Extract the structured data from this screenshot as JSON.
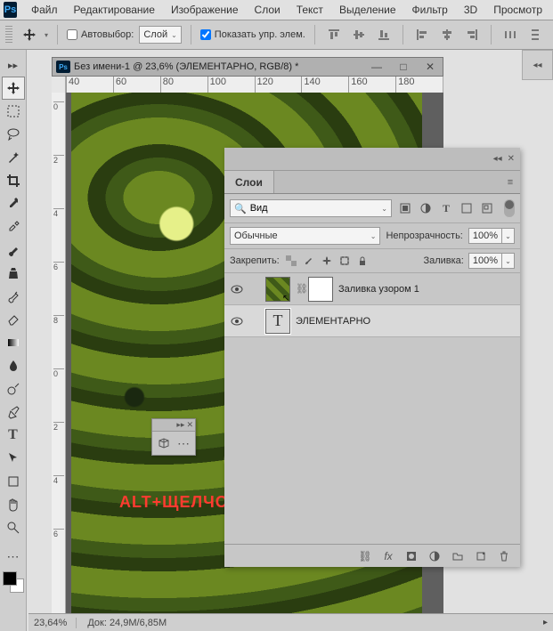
{
  "menu": {
    "items": [
      "Файл",
      "Редактирование",
      "Изображение",
      "Слои",
      "Текст",
      "Выделение",
      "Фильтр",
      "3D",
      "Просмотр"
    ]
  },
  "optionbar": {
    "autoselect_label": "Автовыбор:",
    "autoselect_checked": false,
    "scope_value": "Слой",
    "show_controls_label": "Показать упр. элем.",
    "show_controls_checked": true
  },
  "document": {
    "title": "Без имени-1 @ 23,6% (ЭЛЕМЕНТАРНО, RGB/8) *",
    "ruler_h": [
      "40",
      "60",
      "80",
      "100",
      "120",
      "140",
      "160",
      "180"
    ],
    "ruler_v": [
      "0",
      "2",
      "4",
      "6",
      "8",
      "0",
      "2",
      "4",
      "6"
    ]
  },
  "overlay_text": "ALT+ЩЕЛЧОК",
  "layers_panel": {
    "tab": "Слои",
    "search_value": "Вид",
    "blend_mode": "Обычные",
    "opacity_label": "Непрозрачность:",
    "opacity_value": "100%",
    "lock_label": "Закрепить:",
    "fill_label": "Заливка:",
    "fill_value": "100%",
    "layers": [
      {
        "name": "Заливка узором 1",
        "type": "pattern",
        "selected": false
      },
      {
        "name": "ЭЛЕМЕНТАРНО",
        "type": "text",
        "selected": true
      }
    ]
  },
  "status": {
    "zoom": "23,64%",
    "doc_label": "Док:",
    "doc_value": "24,9M/6,85M"
  }
}
